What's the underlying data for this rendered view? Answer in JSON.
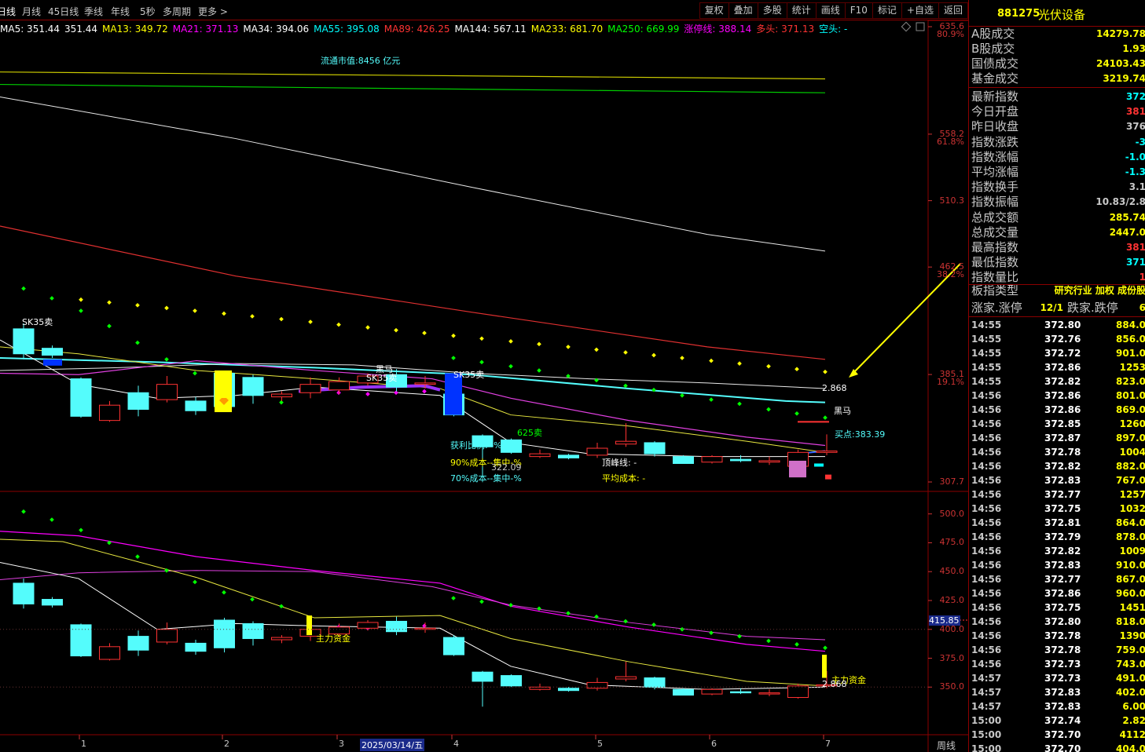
{
  "periods": [
    "日线",
    "月线",
    "45日线",
    "季线",
    "年线",
    "5秒",
    "多周期",
    "更多 >"
  ],
  "tools": [
    "复权",
    "叠加",
    "多股",
    "统计",
    "画线",
    "F10",
    "标记",
    "+自选",
    "返回"
  ],
  "ma_items": [
    {
      "text": "MA5: 351.44",
      "color": "#ffffff"
    },
    {
      "text": "351.44",
      "color": "#ffffff"
    },
    {
      "text": "MA13: 349.72",
      "color": "#ffff00"
    },
    {
      "text": "MA21: 371.13",
      "color": "#ff00ff"
    },
    {
      "text": "MA34: 394.06",
      "color": "#ffffff"
    },
    {
      "text": "MA55: 395.08",
      "color": "#00ffff"
    },
    {
      "text": "MA89: 426.25",
      "color": "#ff3333"
    },
    {
      "text": "MA144: 567.11",
      "color": "#ffffff"
    },
    {
      "text": "MA233: 681.70",
      "color": "#ffff00"
    },
    {
      "text": "MA250: 669.99",
      "color": "#00ff00"
    },
    {
      "text": "涨停线: 388.14",
      "color": "#ff00ff"
    },
    {
      "text": "多头: 371.13",
      "color": "#ff3333"
    },
    {
      "text": "空头: -",
      "color": "#00ffff"
    }
  ],
  "upper_axis": [
    {
      "label": "635.6",
      "pct": "80.9%"
    },
    {
      "label": "558.2",
      "pct": "61.8%"
    },
    {
      "label": "510.3",
      "pct": ""
    },
    {
      "label": "462.5",
      "pct": "38.2%"
    },
    {
      "label": "385.1",
      "pct": "19.1%"
    },
    {
      "label": "307.7",
      "pct": ""
    }
  ],
  "lower_axis": [
    "500.0",
    "475.0",
    "450.0",
    "425.0",
    "400.0",
    "375.0",
    "350.0"
  ],
  "lower_current": "415.85",
  "x_labels": [
    "1",
    "2",
    "3",
    "2025/03/14/五",
    "4",
    "5",
    "6",
    "7"
  ],
  "x_period": "周线",
  "annotations": {
    "market_cap": "流通市值:8456  亿元",
    "sk35_1": "SK35卖",
    "sk35_2": "SK35卖",
    "sk35_3": "SK35卖",
    "heima_1": "黑马",
    "heima_2": "黑马",
    "sell_625": "625卖",
    "profit": "获利比例: -%",
    "cost90": "90%成本--集中-%",
    "cost70": "70%成本--集中-%",
    "peak": "顶峰线: -",
    "avgcost": "平均成本: -",
    "low_price": "322.09",
    "price_2868": "2.868",
    "buy_point": "买点:383.39",
    "zhuli_1": "主力资金",
    "zhuli_2": "主力资金",
    "val_2868b": "2.868"
  },
  "sidebar": {
    "code": "881275",
    "name": "光伏设备",
    "stats": [
      {
        "k": "A股成交",
        "v": "14279.78",
        "c": "#ffff00"
      },
      {
        "k": "B股成交",
        "v": "1.93",
        "c": "#ffff00"
      },
      {
        "k": "国债成交",
        "v": "24103.43",
        "c": "#ffff00"
      },
      {
        "k": "基金成交",
        "v": "3219.74",
        "c": "#ffff00"
      }
    ],
    "index": [
      {
        "k": "最新指数",
        "v": "372",
        "c": "#00ffff"
      },
      {
        "k": "今日开盘",
        "v": "381",
        "c": "#ff3333"
      },
      {
        "k": "昨日收盘",
        "v": "376",
        "c": "#c8c8c8"
      },
      {
        "k": "指数涨跌",
        "v": "-3",
        "c": "#00ffff"
      },
      {
        "k": "指数涨幅",
        "v": "-1.0",
        "c": "#00ffff"
      },
      {
        "k": "平均涨幅",
        "v": "-1.3",
        "c": "#00ffff"
      },
      {
        "k": "指数换手",
        "v": "3.1",
        "c": "#c8c8c8"
      },
      {
        "k": "指数振幅",
        "v": "10.83/2.8",
        "c": "#c8c8c8"
      },
      {
        "k": "总成交额",
        "v": "285.74",
        "c": "#ffff00"
      },
      {
        "k": "总成交量",
        "v": "2447.0",
        "c": "#ffff00"
      },
      {
        "k": "最高指数",
        "v": "381",
        "c": "#ff3333"
      },
      {
        "k": "最低指数",
        "v": "371",
        "c": "#00ffff"
      },
      {
        "k": "指数量比",
        "v": "1",
        "c": "#ff3333"
      }
    ],
    "board_type_label": "板指类型",
    "board_type_value": "研究行业 加权 成份股",
    "rise_label": "涨家.涨停",
    "rise_value": "12/1",
    "fall_label": "跌家.跌停",
    "fall_value": "6",
    "ticks": [
      {
        "t": "14:55",
        "p": "372.80",
        "v": "884.0"
      },
      {
        "t": "14:55",
        "p": "372.76",
        "v": "856.0"
      },
      {
        "t": "14:55",
        "p": "372.72",
        "v": "901.0"
      },
      {
        "t": "14:55",
        "p": "372.86",
        "v": "1253"
      },
      {
        "t": "14:55",
        "p": "372.82",
        "v": "823.0"
      },
      {
        "t": "14:56",
        "p": "372.86",
        "v": "801.0"
      },
      {
        "t": "14:56",
        "p": "372.86",
        "v": "869.0"
      },
      {
        "t": "14:56",
        "p": "372.85",
        "v": "1260"
      },
      {
        "t": "14:56",
        "p": "372.87",
        "v": "897.0"
      },
      {
        "t": "14:56",
        "p": "372.78",
        "v": "1004"
      },
      {
        "t": "14:56",
        "p": "372.82",
        "v": "882.0"
      },
      {
        "t": "14:56",
        "p": "372.83",
        "v": "767.0"
      },
      {
        "t": "14:56",
        "p": "372.77",
        "v": "1257"
      },
      {
        "t": "14:56",
        "p": "372.75",
        "v": "1032"
      },
      {
        "t": "14:56",
        "p": "372.81",
        "v": "864.0"
      },
      {
        "t": "14:56",
        "p": "372.79",
        "v": "878.0"
      },
      {
        "t": "14:56",
        "p": "372.82",
        "v": "1009"
      },
      {
        "t": "14:56",
        "p": "372.83",
        "v": "910.0"
      },
      {
        "t": "14:56",
        "p": "372.77",
        "v": "867.0"
      },
      {
        "t": "14:56",
        "p": "372.86",
        "v": "960.0"
      },
      {
        "t": "14:56",
        "p": "372.75",
        "v": "1451"
      },
      {
        "t": "14:56",
        "p": "372.80",
        "v": "818.0"
      },
      {
        "t": "14:56",
        "p": "372.78",
        "v": "1390"
      },
      {
        "t": "14:56",
        "p": "372.78",
        "v": "759.0"
      },
      {
        "t": "14:56",
        "p": "372.73",
        "v": "743.0"
      },
      {
        "t": "14:57",
        "p": "372.73",
        "v": "491.0"
      },
      {
        "t": "14:57",
        "p": "372.83",
        "v": "402.0"
      },
      {
        "t": "14:57",
        "p": "372.83",
        "v": "6.00"
      },
      {
        "t": "15:00",
        "p": "372.74",
        "v": "2.82"
      },
      {
        "t": "15:00",
        "p": "372.70",
        "v": "4112"
      },
      {
        "t": "15:00",
        "p": "372.70",
        "v": "404.0"
      }
    ]
  },
  "chart_data": {
    "type": "candlestick",
    "title": "",
    "x_label_date": "2025/03/14/五",
    "period": "周线",
    "upper_ylim": [
      307.7,
      635.6
    ],
    "lower_ylim": [
      340,
      510
    ],
    "candles": [
      {
        "o": 418,
        "c": 400,
        "h": 422,
        "l": 396
      },
      {
        "o": 404,
        "c": 399,
        "h": 406,
        "l": 397
      },
      {
        "o": 382,
        "c": 355,
        "h": 383,
        "l": 354
      },
      {
        "o": 352,
        "c": 363,
        "h": 366,
        "l": 351
      },
      {
        "o": 372,
        "c": 360,
        "h": 377,
        "l": 355
      },
      {
        "o": 367,
        "c": 378,
        "h": 384,
        "l": 365
      },
      {
        "o": 366,
        "c": 359,
        "h": 369,
        "l": 356
      },
      {
        "o": 386,
        "c": 362,
        "h": 388,
        "l": 358
      },
      {
        "o": 383,
        "c": 370,
        "h": 385,
        "l": 364
      },
      {
        "o": 369,
        "c": 371,
        "h": 373,
        "l": 366
      },
      {
        "o": 372,
        "c": 378,
        "h": 383,
        "l": 368
      },
      {
        "o": 374,
        "c": 380,
        "h": 383,
        "l": 371
      },
      {
        "o": 379,
        "c": 384,
        "h": 386,
        "l": 377
      },
      {
        "o": 385,
        "c": 376,
        "h": 389,
        "l": 373
      },
      {
        "o": 378,
        "c": 379,
        "h": 384,
        "l": 375
      },
      {
        "o": 371,
        "c": 356,
        "h": 373,
        "l": 355
      },
      {
        "o": 341,
        "c": 333,
        "h": 342,
        "l": 311
      },
      {
        "o": 338,
        "c": 329,
        "h": 339,
        "l": 328
      },
      {
        "o": 326,
        "c": 328,
        "h": 331,
        "l": 325
      },
      {
        "o": 327,
        "c": 325,
        "h": 328,
        "l": 324
      },
      {
        "o": 327,
        "c": 332,
        "h": 336,
        "l": 325
      },
      {
        "o": 335,
        "c": 337,
        "h": 350,
        "l": 333
      },
      {
        "o": 336,
        "c": 328,
        "h": 337,
        "l": 326
      },
      {
        "o": 326,
        "c": 321,
        "h": 327,
        "l": 321
      },
      {
        "o": 322,
        "c": 326,
        "h": 327,
        "l": 321
      },
      {
        "o": 324,
        "c": 323,
        "h": 327,
        "l": 322
      },
      {
        "o": 322,
        "c": 323,
        "h": 326,
        "l": 320
      },
      {
        "o": 319,
        "c": 329,
        "h": 331,
        "l": 318
      },
      {
        "o": 329,
        "c": 330,
        "h": 342,
        "l": 327
      }
    ]
  },
  "colors": {
    "up": "#ff3232",
    "down": "#54fcfc",
    "border": "#8b0000",
    "yellow": "#ffff00",
    "magenta": "#ff00ff",
    "green_dot": "#00ff00"
  }
}
